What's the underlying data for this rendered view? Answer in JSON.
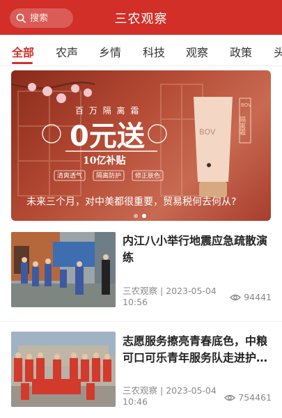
{
  "header": {
    "search_placeholder": "搜索",
    "title": "三农观察"
  },
  "tabs": [
    {
      "label": "全部",
      "active": true
    },
    {
      "label": "农声",
      "active": false
    },
    {
      "label": "乡情",
      "active": false
    },
    {
      "label": "科技",
      "active": false
    },
    {
      "label": "观察",
      "active": false
    },
    {
      "label": "政策",
      "active": false
    },
    {
      "label": "头",
      "active": false
    }
  ],
  "banner": {
    "ad_top_text": "百 万 隔 离 霜",
    "ad_big_text": "0元送",
    "ad_sub_text": "10亿补贴",
    "ad_tags": [
      "清爽透气",
      "隔离防护",
      "修正肤色"
    ],
    "product_brand": "BOV",
    "product_tag": "隔离霜",
    "caption": "未来三个月，对中美都很重要，贸易税何去何从?",
    "slides_total": 2,
    "current_slide": 2
  },
  "news": [
    {
      "title": "内江八小举行地震应急疏散演练",
      "source": "三农观察",
      "date": "2023-05-04",
      "time": "10:56",
      "views": "94441"
    },
    {
      "title": "志愿服务擦亮青春底色，中粮可口可乐青年服务队走进护…",
      "source": "三农观察",
      "date": "2023-05-04",
      "time": "10:46",
      "views": "754461"
    }
  ],
  "colors": {
    "brand_red": "#d12f27",
    "text_gray": "#888888"
  }
}
